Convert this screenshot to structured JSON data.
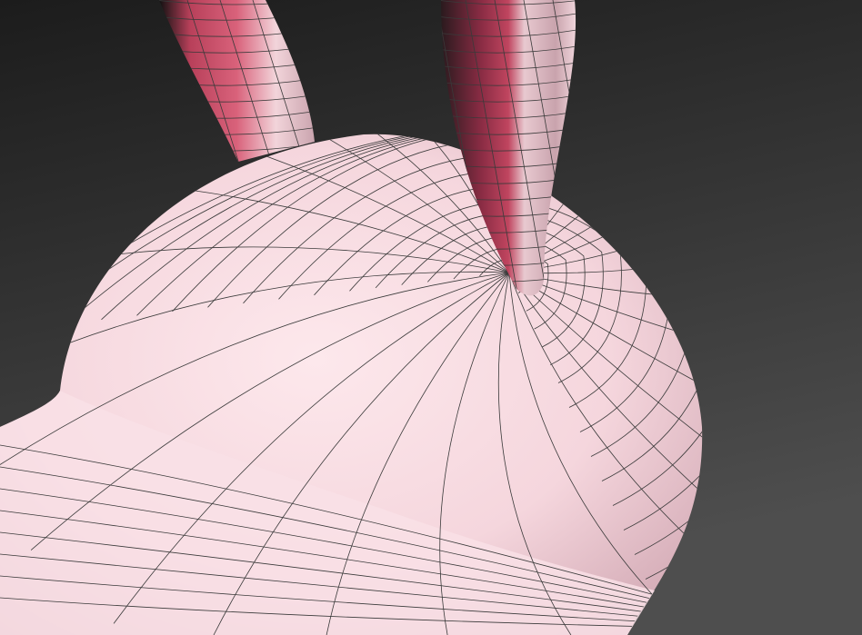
{
  "viewport": {
    "subject": "bunny-ear-cap-mesh",
    "colors": {
      "background_top": "#1c1c1c",
      "background_bottom": "#4e4e4e",
      "mesh_base": "#f7dde3",
      "mesh_shadow": "#d9b3bd",
      "ear_inner": "#c0455f",
      "wireframe": "#3a3a3a"
    }
  }
}
